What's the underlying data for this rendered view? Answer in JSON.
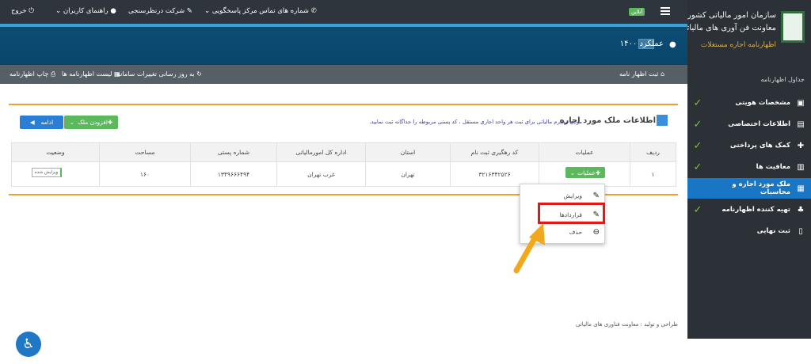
{
  "sidebar": {
    "org_line1": "سازمان امور مالیاتی کشور",
    "org_line2": "معاونت فن آوری های مالیاتی",
    "system_name": "اظهارنامه اجاره مستغلات",
    "section_title": "جداول اظهارنامه",
    "items": [
      {
        "label": "مشخصات هویتی",
        "icon": "id-card-icon",
        "checked": true
      },
      {
        "label": "اطلاعات اختصاصی",
        "icon": "document-icon",
        "checked": true
      },
      {
        "label": "کمک های پرداختی",
        "icon": "medkit-icon",
        "checked": true
      },
      {
        "label": "معافیت ها",
        "icon": "percent-icon",
        "checked": true
      },
      {
        "label": "ملک مورد اجاره و محاسبات",
        "icon": "building-icon",
        "checked": false,
        "active": true
      },
      {
        "label": "تهیه کننده اظهارنامه",
        "icon": "sitemap-icon",
        "checked": true
      },
      {
        "label": "ثبت نهایی",
        "icon": "file-icon",
        "checked": false
      }
    ]
  },
  "topbar": {
    "online_badge": "آنلاین",
    "contact_numbers": "شماره های تماس مرکز پاسخگویی",
    "survey": "شرکت درنظرسنجی",
    "user_guide": "راهنمای کاربران",
    "logout": "خروج"
  },
  "header": {
    "title": "عملکرد ۱۴۰۰"
  },
  "toolbar": {
    "submit": "ثبت اظهار نامه",
    "refresh": "به روز رسانی تغییرات سامانه",
    "list": "لیست اظهارنامه ها",
    "print": "چاپ اظهارنامه"
  },
  "panel": {
    "title": "اطلاعات ملک مورد اجاره",
    "note": "مودی محترم مالیاتی برای ثبت هر واحد اجاری مستقل ، کد پستی مربوطه را جداگانه ثبت نمایید.",
    "add_property_button": "افزودن ملک",
    "continue_button": "ادامه"
  },
  "table": {
    "headers": [
      "ردیف",
      "عملیات",
      "کد رهگیری ثبت نام",
      "استان",
      "اداره کل امورمالیاتی",
      "شماره پستی",
      "مساحت",
      "وضعیت"
    ],
    "rows": [
      {
        "index": "۱",
        "operations": "عملیات",
        "tracking_code": "۳۲۱۶۳۴۲۵۲۶",
        "province": "تهران",
        "tax_office": "غرب تهران",
        "postal_code": "۱۳۴۹۶۶۶۴۹۴",
        "area": "۱۶۰",
        "status": "ویرایش شده"
      }
    ]
  },
  "dropdown": {
    "items": [
      {
        "label": "ویرایش",
        "icon": "edit-icon"
      },
      {
        "label": "قراردادها",
        "icon": "edit-icon"
      },
      {
        "label": "حذف",
        "icon": "minus-circle-icon"
      }
    ]
  },
  "footer": {
    "credits": "طراحی و تولید : معاونت فناوری های مالیاتی"
  },
  "colors": {
    "sidebar_bg": "#2b3137",
    "active_blue": "#1976c4",
    "header_blue": "#0f4d75",
    "check_green": "#7fc241",
    "accent_orange": "#f0a030",
    "highlight_red": "#e01818"
  }
}
